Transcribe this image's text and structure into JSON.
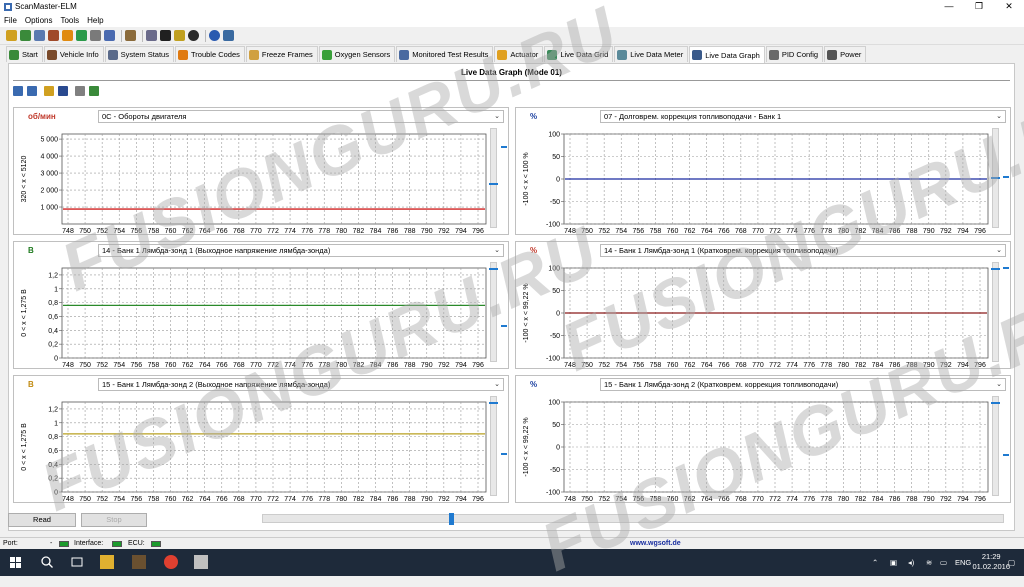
{
  "window": {
    "title": "ScanMaster-ELM",
    "minimize": "—",
    "maximize": "❐",
    "close": "✕"
  },
  "menu": [
    "File",
    "Options",
    "Tools",
    "Help"
  ],
  "tabs": [
    {
      "label": "Start",
      "color": "#3a8a3a"
    },
    {
      "label": "Vehicle Info",
      "color": "#7a4a2a"
    },
    {
      "label": "System Status",
      "color": "#5a6a8a"
    },
    {
      "label": "Trouble Codes",
      "color": "#e07a10"
    },
    {
      "label": "Freeze Frames",
      "color": "#d0a040"
    },
    {
      "label": "Oxygen Sensors",
      "color": "#3aa03a"
    },
    {
      "label": "Monitored Test Results",
      "color": "#4a6aa0"
    },
    {
      "label": "Actuator",
      "color": "#e0a020"
    },
    {
      "label": "Live Data Grid",
      "color": "#3a8a5a"
    },
    {
      "label": "Live Data Meter",
      "color": "#5a8a9a"
    },
    {
      "label": "Live Data Graph",
      "color": "#3a5a8a",
      "active": true
    },
    {
      "label": "PID Config",
      "color": "#6a6a6a"
    },
    {
      "label": "Power",
      "color": "#555555"
    }
  ],
  "graph_page_title": "Live Data Graph (Mode 01)",
  "x_ticks": [
    "748",
    "750",
    "752",
    "754",
    "756",
    "758",
    "760",
    "762",
    "764",
    "766",
    "768",
    "770",
    "772",
    "774",
    "776",
    "778",
    "780",
    "782",
    "784",
    "786",
    "788",
    "790",
    "792",
    "794",
    "796"
  ],
  "panels": [
    {
      "unit": "об/мин",
      "unit_color": "#c0392b",
      "pid": "0C - Обороты двигателя",
      "range_label": "320  < x <  5120",
      "yticks": [
        "5 000",
        "4 000",
        "3 000",
        "2 000",
        "1 000"
      ],
      "line_color": "#d02020",
      "ylim": [
        0,
        5300
      ],
      "value": 880,
      "bar_level": 0.46,
      "scale_level": 0.82
    },
    {
      "unit": "%",
      "unit_color": "#1a3fa0",
      "pid": "07 - Долговрем. коррекция топливоподачи - Банк 1",
      "range_label": "-100  < x <  100  %",
      "yticks": [
        "100",
        "50",
        "0",
        "-50",
        "-100"
      ],
      "line_color": "#1a2aa0",
      "ylim": [
        -100,
        100
      ],
      "value": 0,
      "bar_level": 0.52,
      "scale_level": 0.52
    },
    {
      "unit": "В",
      "unit_color": "#1e7a1e",
      "pid": "14 - Банк 1 Лямбда-зонд 1 (Выходное напряжение лямбда-зонда)",
      "range_label": "0  < x <  1,275  В",
      "yticks": [
        "1,2",
        "1",
        "0,8",
        "0,6",
        "0,4",
        "0,2",
        "0"
      ],
      "line_color": "#2a8a2a",
      "ylim": [
        0,
        1.3
      ],
      "value": 0.76,
      "bar_level": 0.95,
      "scale_level": 0.37
    },
    {
      "unit": "%",
      "unit_color": "#c0392b",
      "pid": "14 - Банк 1 Лямбда-зонд 1 (Кратковрем. коррекция топливоподачи)",
      "range_label": "-100  < x <  99,22  %",
      "yticks": [
        "100",
        "50",
        "0",
        "-50",
        "-100"
      ],
      "line_color": "#8a1a1a",
      "ylim": [
        -100,
        100
      ],
      "value": 0,
      "bar_level": 0.95,
      "scale_level": 0.95
    },
    {
      "unit": "В",
      "unit_color": "#c08a10",
      "pid": "15 - Банк 1 Лямбда-зонд 2 (Выходное напряжение лямбда-зонда)",
      "range_label": "0  < x <  1,275  В",
      "yticks": [
        "1,2",
        "1",
        "0,8",
        "0,6",
        "0,4",
        "0,2",
        "0"
      ],
      "line_color": "#b8a020",
      "ylim": [
        0,
        1.3
      ],
      "value": 0.84,
      "bar_level": 0.95,
      "scale_level": 0.43
    },
    {
      "unit": "%",
      "unit_color": "#1a3fa0",
      "pid": "15 - Банк 1 Лямбда-зонд 2 (Кратковрем. коррекция топливоподачи)",
      "range_label": "-100  < x <  99,22  %",
      "yticks": [
        "100",
        "50",
        "0",
        "-50",
        "-100"
      ],
      "line_color": "#1a2aa0",
      "ylim": [
        -100,
        100
      ],
      "value": null,
      "bar_level": 0.95,
      "scale_level": 0.42
    }
  ],
  "controls": {
    "read": "Read",
    "stop": "Stop",
    "slider_position": 0.25
  },
  "status": {
    "port": "Port:",
    "port_value": "-",
    "interface": "Interface:",
    "ecu": "ECU:",
    "url": "www.wgsoft.de"
  },
  "taskbar": {
    "lang": "ENG",
    "time": "21:29",
    "date": "01.02.2016"
  },
  "watermark": "FUSIONGURU.RU"
}
